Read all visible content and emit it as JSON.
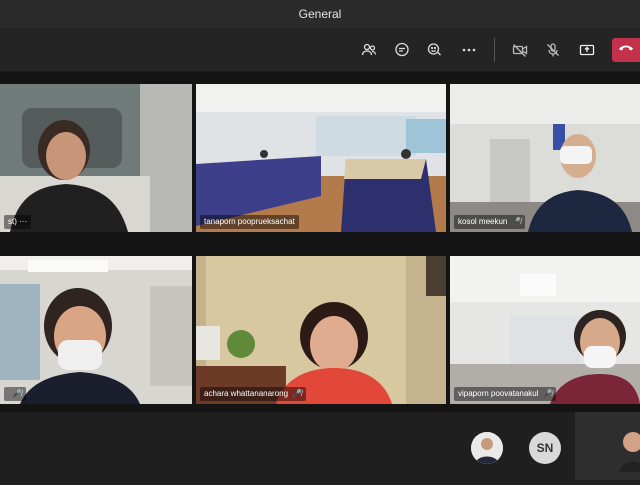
{
  "window": {
    "title": "General"
  },
  "toolbar": {
    "icons": [
      "participants-icon",
      "chat-icon",
      "reactions-icon",
      "more-icon",
      "camera-off-icon",
      "mic-off-icon",
      "share-icon",
      "hangup-icon"
    ]
  },
  "tiles": [
    {
      "name": "st)",
      "extra": "···",
      "muted": false
    },
    {
      "name": "tanaporn pooprueksachat",
      "muted": false
    },
    {
      "name": "kosol meekun",
      "muted": true
    },
    {
      "name": "",
      "muted": true
    },
    {
      "name": "achara whattananarong",
      "muted": true
    },
    {
      "name": "vipaporn poovatanakul",
      "muted": true
    }
  ],
  "bottom": {
    "avatar_initials": "SN"
  },
  "colors": {
    "leave": "#c4314b",
    "background": "#1f1f1f"
  }
}
